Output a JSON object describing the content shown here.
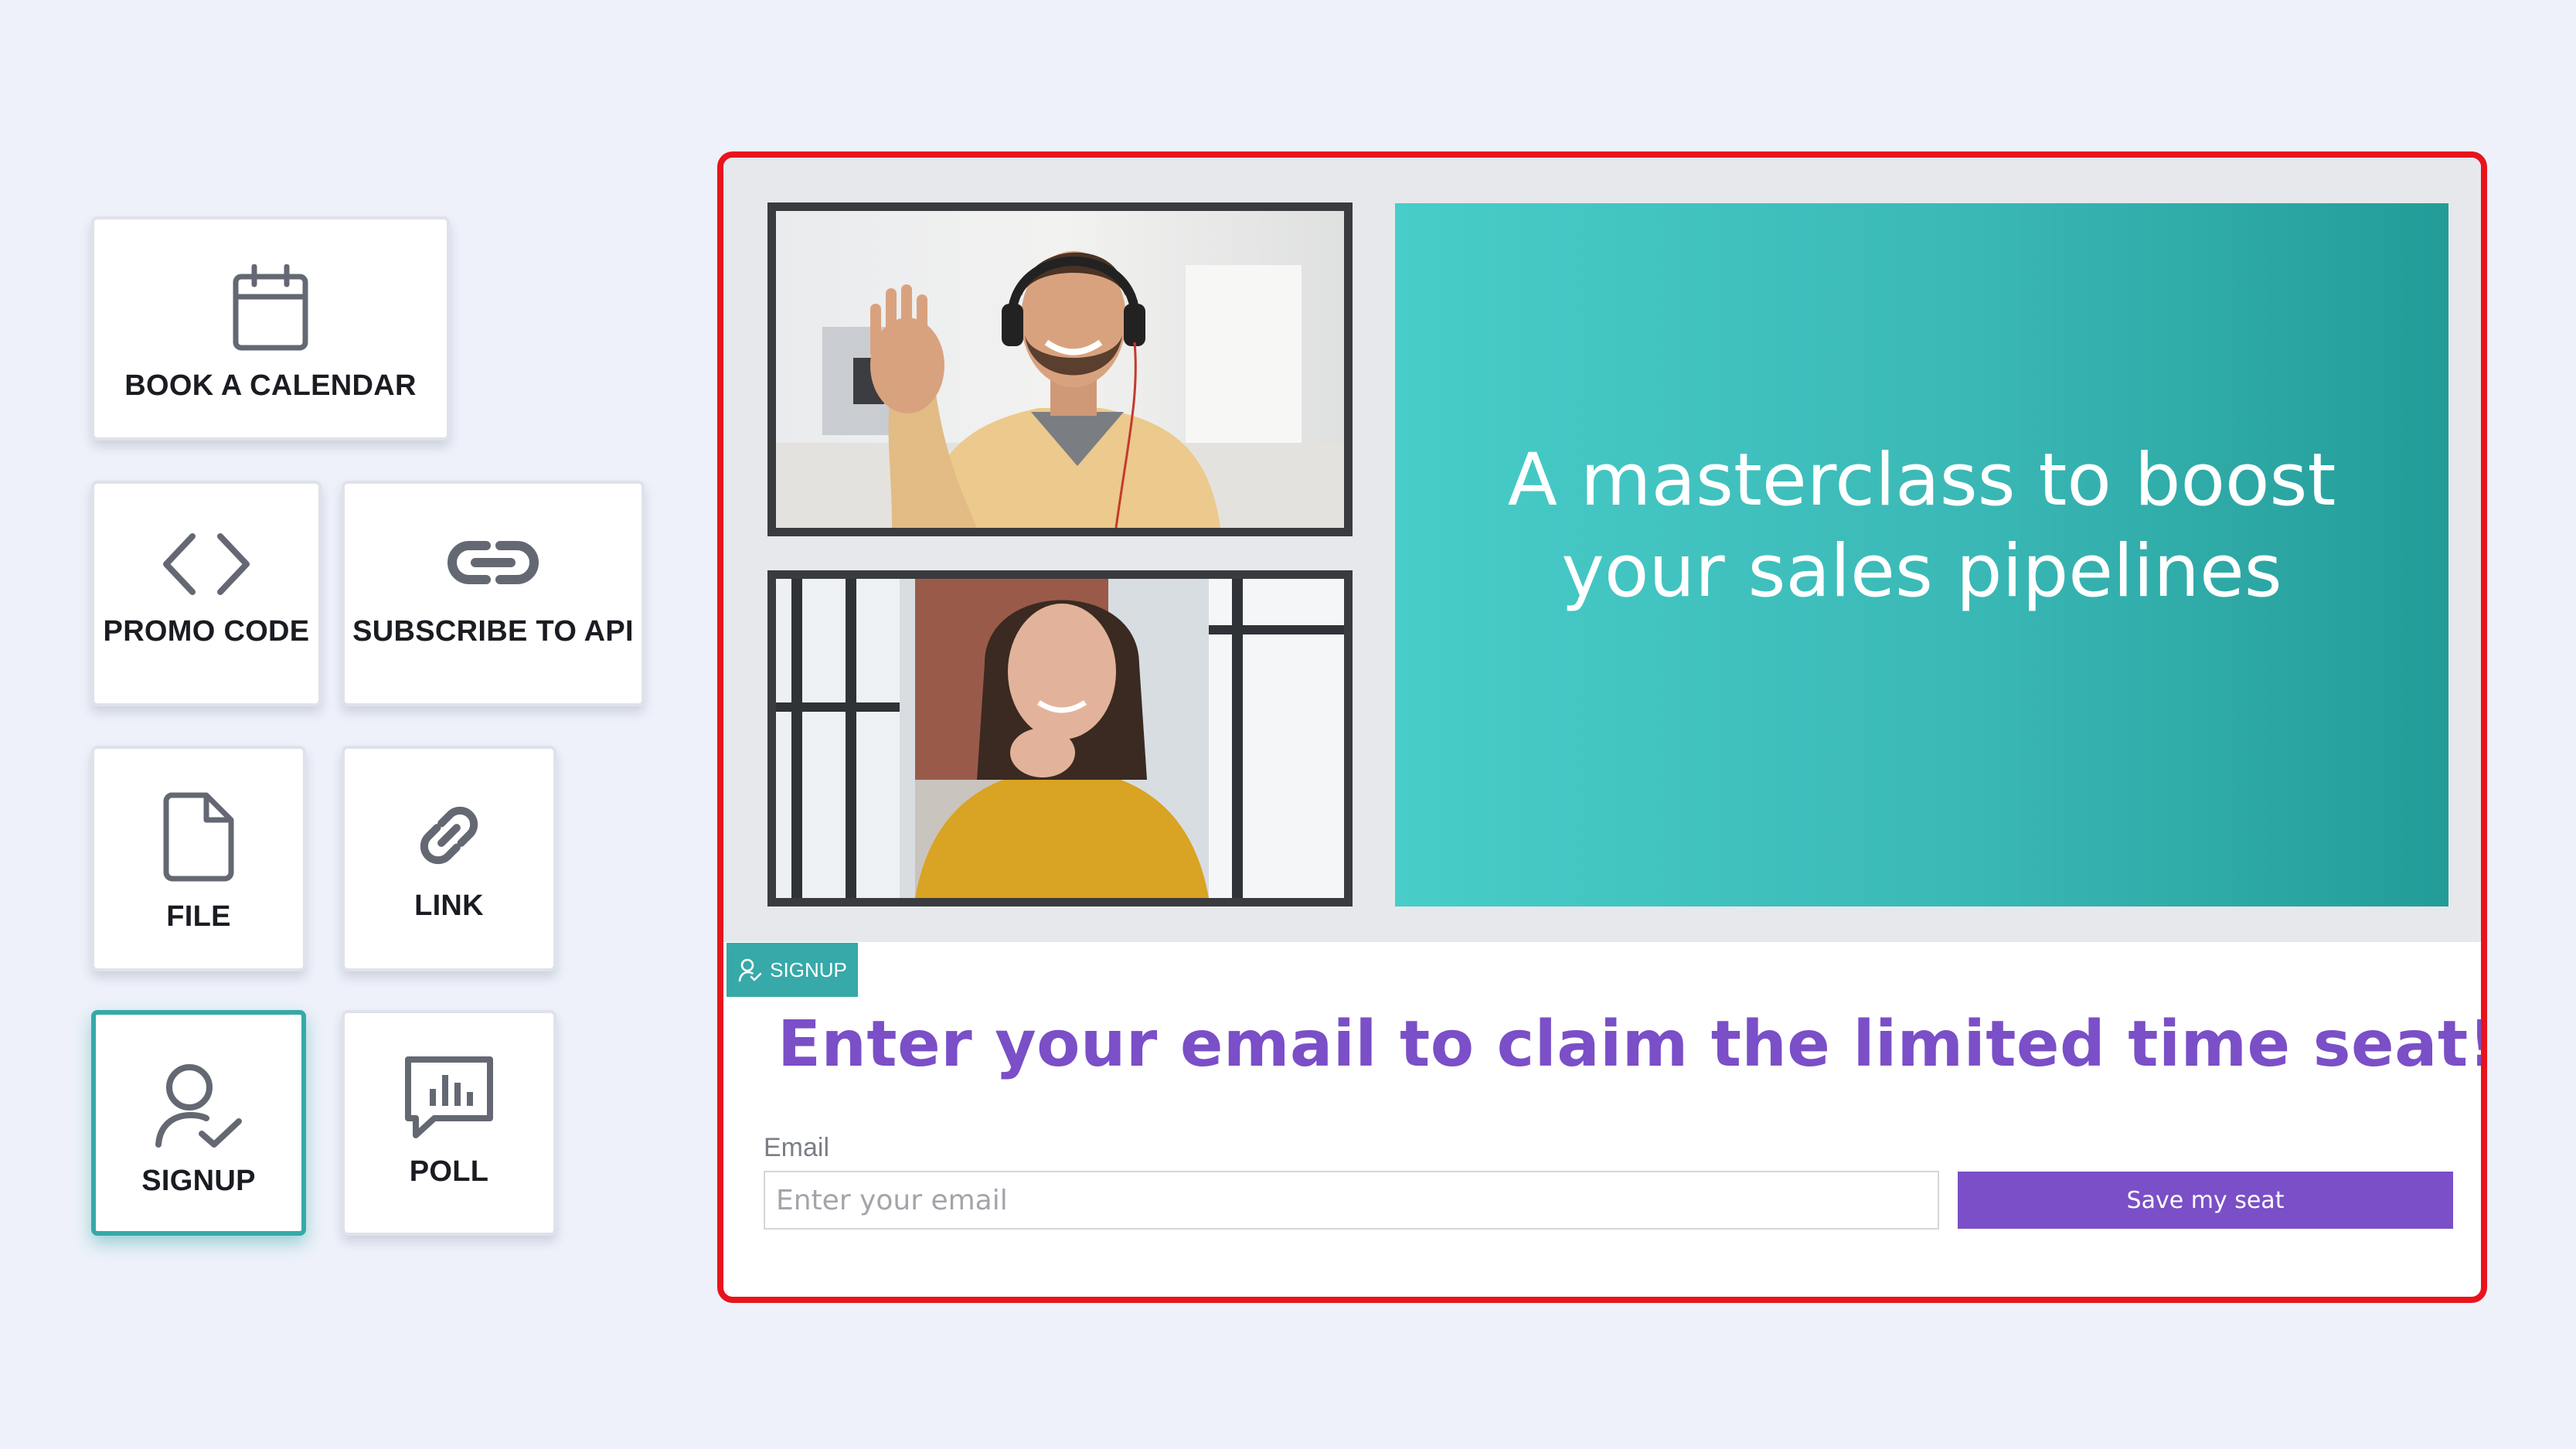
{
  "colors": {
    "accent_teal": "#36a9a8",
    "accent_purple": "#7a4fc7",
    "frame_red": "#e8141d",
    "tile_icon": "#646873"
  },
  "widgets": [
    {
      "label": "BOOK A CALENDAR",
      "icon": "calendar-icon"
    },
    {
      "label": "PROMO CODE",
      "icon": "code-icon"
    },
    {
      "label": "SUBSCRIBE TO API",
      "icon": "link-chain-icon"
    },
    {
      "label": "FILE",
      "icon": "file-icon"
    },
    {
      "label": "LINK",
      "icon": "link-icon"
    },
    {
      "label": "SIGNUP",
      "icon": "user-check-icon",
      "selected": true
    },
    {
      "label": "POLL",
      "icon": "poll-chart-icon"
    }
  ],
  "stage": {
    "headline": "A masterclass to boost your sales pipelines",
    "participants": [
      {
        "icon": "participant-man-headset-photo"
      },
      {
        "icon": "participant-woman-photo"
      }
    ],
    "badge_label": "SIGNUP",
    "claim_text": "Enter your email to claim the limited time seat!",
    "email_label": "Email",
    "email_placeholder": "Enter your email",
    "submit_label": "Save my seat"
  }
}
